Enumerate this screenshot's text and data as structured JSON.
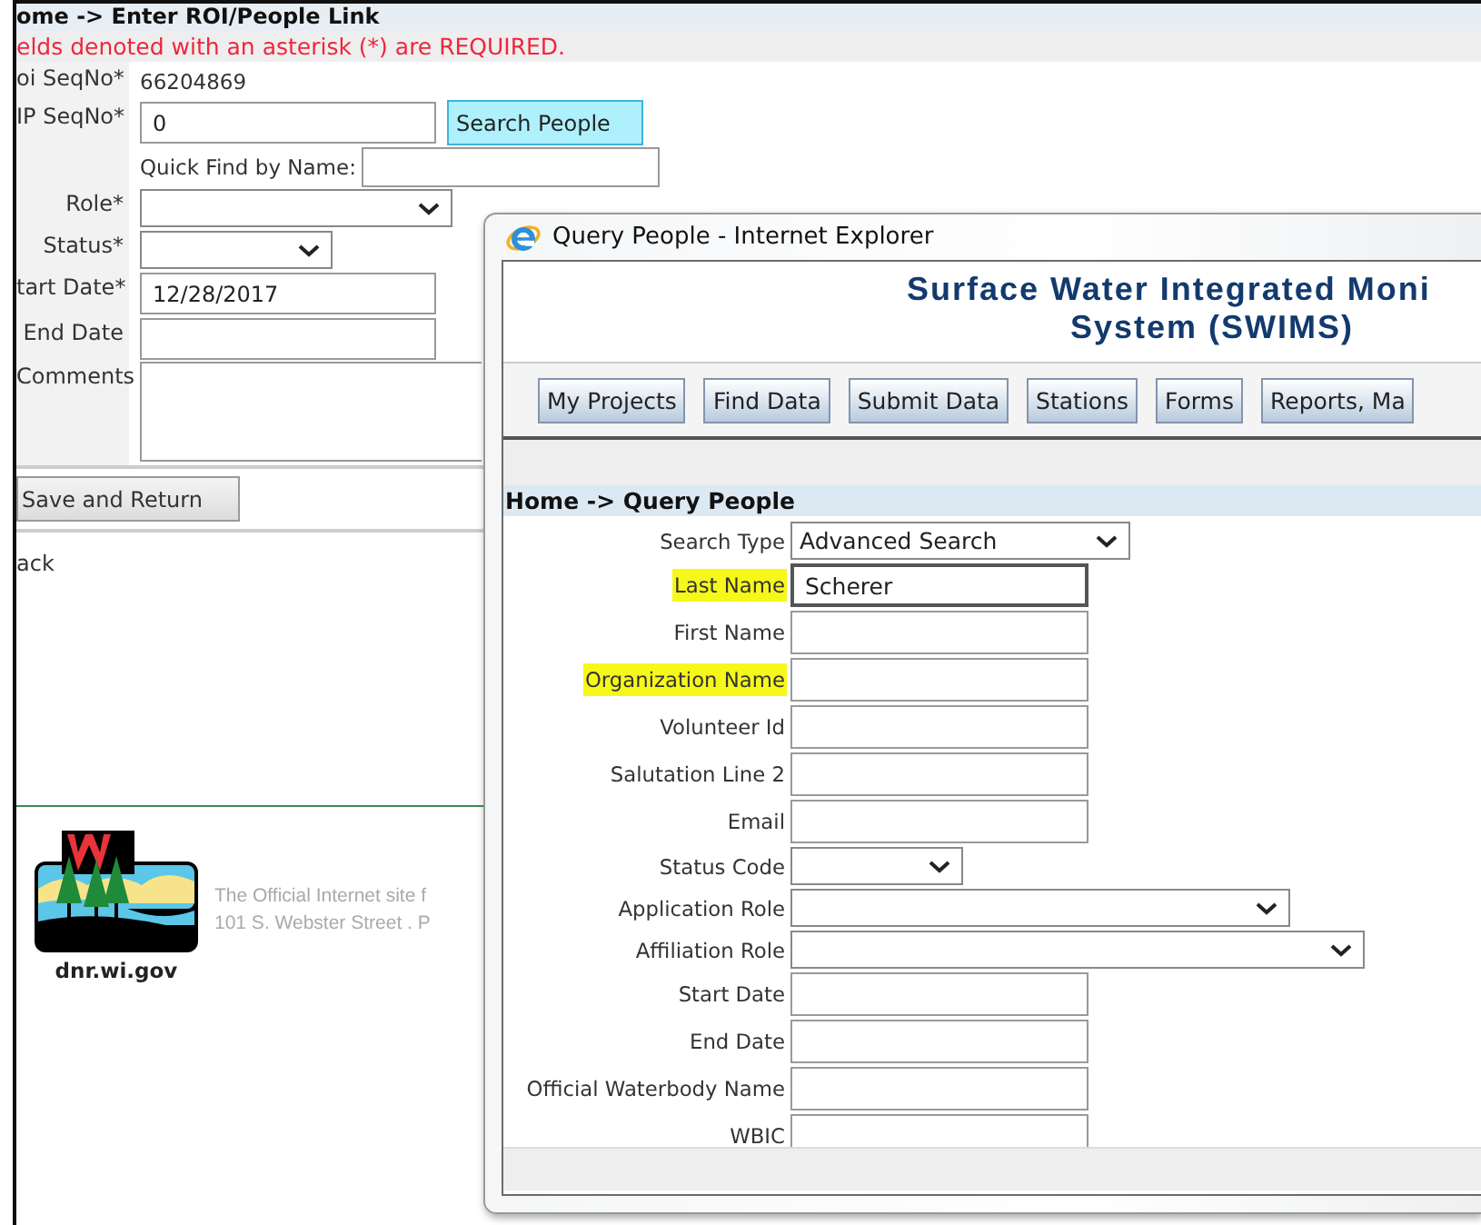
{
  "main_page": {
    "breadcrumb": "ome -> Enter ROI/People Link",
    "required_note": "elds denoted with an asterisk (*) are REQUIRED.",
    "fields": [
      {
        "label": "oi SeqNo*",
        "kind": "static",
        "value": "66204869"
      },
      {
        "label": "IP SeqNo*",
        "kind": "text",
        "value": "0",
        "button": "Search People"
      },
      {
        "kind": "quickfind",
        "label": "Quick Find by Name:"
      },
      {
        "label": "Role*",
        "kind": "select"
      },
      {
        "label": "Status*",
        "kind": "select"
      },
      {
        "label": "tart Date*",
        "kind": "text",
        "value": "12/28/2017"
      },
      {
        "label": "End Date",
        "kind": "text"
      },
      {
        "label": "Comments",
        "kind": "textarea"
      }
    ],
    "save_button": "Save and Return",
    "back_link": "ack",
    "footer": {
      "logo_caption": "dnr.wi.gov",
      "lines": [
        "The Official Internet site f",
        "101 S. Webster Street . P"
      ]
    }
  },
  "query_window": {
    "title": "Query People - Internet Explorer",
    "site_title_lines": [
      "Surface Water Integrated Moni",
      "System (SWIMS)"
    ],
    "nav_tabs": [
      "My Projects",
      "Find Data",
      "Submit Data",
      "Stations",
      "Forms",
      "Reports, Ma"
    ],
    "breadcrumb": "Home -> Query People",
    "fields": [
      {
        "label": "Search Type",
        "kind": "select",
        "value": "Advanced Search",
        "highlighted": false
      },
      {
        "label": "Last Name",
        "kind": "text",
        "value": "Scherer",
        "highlighted": true,
        "focused": true
      },
      {
        "label": "First Name",
        "kind": "text",
        "highlighted": false,
        "focused": false
      },
      {
        "label": "Organization Name",
        "kind": "text",
        "highlighted": true,
        "focused": false
      },
      {
        "label": "Volunteer Id",
        "kind": "text",
        "highlighted": false,
        "focused": false
      },
      {
        "label": "Salutation Line 2",
        "kind": "text",
        "highlighted": false,
        "focused": false
      },
      {
        "label": "Email",
        "kind": "text",
        "highlighted": false,
        "focused": false
      },
      {
        "label": "Status Code",
        "kind": "select",
        "highlighted": false
      },
      {
        "label": "Application Role",
        "kind": "select",
        "highlighted": false
      },
      {
        "label": "Affiliation Role",
        "kind": "select",
        "highlighted": false
      },
      {
        "label": "Start Date",
        "kind": "text",
        "highlighted": false,
        "focused": false
      },
      {
        "label": "End Date",
        "kind": "text",
        "highlighted": false,
        "focused": false
      },
      {
        "label": "Official Waterbody Name",
        "kind": "text",
        "highlighted": false,
        "focused": false
      },
      {
        "label": "WBIC",
        "kind": "text",
        "highlighted": false,
        "focused": false
      }
    ]
  }
}
